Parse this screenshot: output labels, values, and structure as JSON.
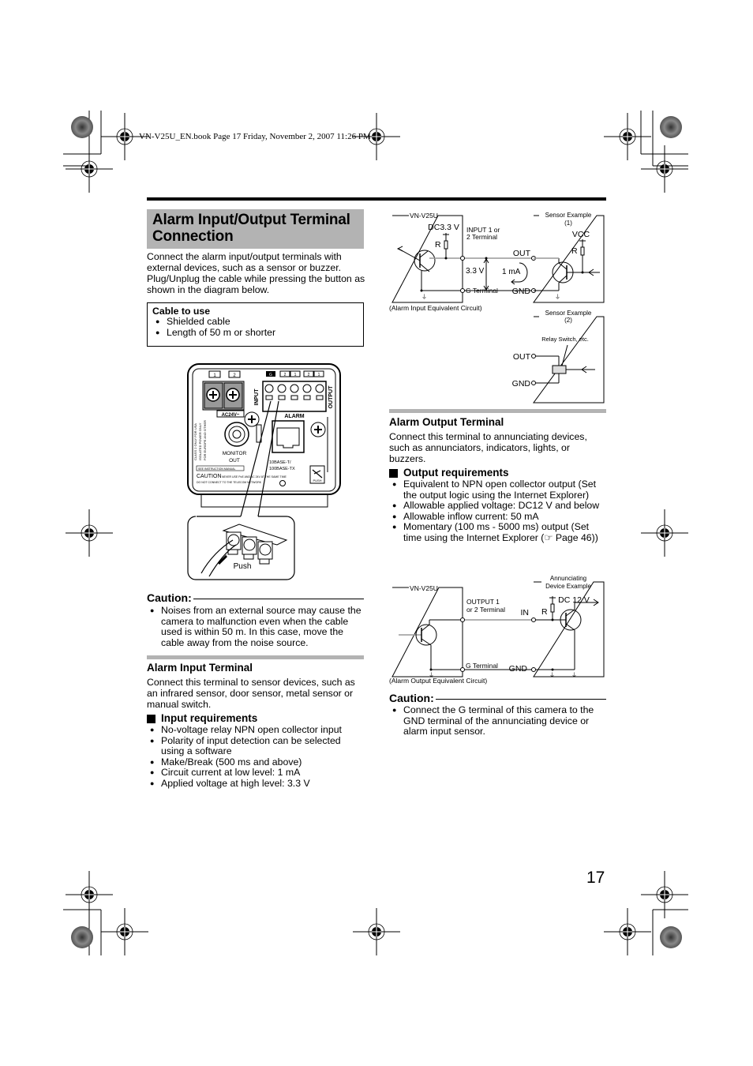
{
  "header": {
    "print_line": "VN-V25U_EN.book  Page 17  Friday, November 2, 2007  11:26 PM"
  },
  "page_title": "Alarm Input/Output Terminal Connection",
  "title_lines": [
    "Alarm Input/Output Terminal",
    "Connection"
  ],
  "intro": "Connect the alarm input/output terminals with external devices, such as a sensor or buzzer. Plug/Unplug the cable while pressing the button as shown in the diagram below.",
  "cable_box": {
    "heading": "Cable to use",
    "items": [
      "Shielded cable",
      "Length of 50 m or shorter"
    ]
  },
  "camera_diagram": {
    "power_terminals": [
      "1",
      "2"
    ],
    "power_label": "AC24V~",
    "alarm_terminals": [
      "G",
      "2",
      "1",
      "2",
      "1"
    ],
    "input_label": "INPUT",
    "output_label": "OUTPUT",
    "alarm_label": "ALARM",
    "monitor_label": [
      "MONITOR",
      "OUT"
    ],
    "network_label": [
      "10BASE-T/",
      "100BASE-TX"
    ],
    "poe_label": "PoE",
    "class2_label": [
      "CLASS 2 ONLY FOR USA",
      "ISOLATED POWER ONLY",
      "FOR EUROPE AND OTHER"
    ],
    "instruction_label": "SEE INSTRUCTION MANUAL",
    "caution_label": "CAUTION",
    "caution_small_1": "NEVER USE PoE AND AC 24V AT THE SAME TIME",
    "caution_small_2": "DO NOT CONNECT TO THE TELECOM NETWORK",
    "push_icon_label": "PUSH",
    "push_callout": "Push"
  },
  "caution_left": {
    "heading": "Caution:",
    "items": [
      "Noises from an external source may cause the camera to malfunction even when the cable used is within 50 m. In this case, move the cable away from the noise source."
    ]
  },
  "alarm_input": {
    "heading": "Alarm Input Terminal",
    "body": "Connect this terminal to sensor devices, such as an infrared sensor, door sensor, metal sensor or manual switch.",
    "req_heading": "Input requirements",
    "items": [
      "No-voltage relay NPN open collector input",
      "Polarity of input detection can be selected using a software",
      "Make/Break (500 ms and above)",
      "Circuit current at low level: 1 mA",
      "Applied voltage at high level: 3.3 V"
    ]
  },
  "input_circuit": {
    "device": "VN-V25U",
    "supply": "DC3.3 V",
    "resistor": "R",
    "terminal": [
      "INPUT 1 or",
      "2 Terminal"
    ],
    "voltage": "3.3 V",
    "current": "1 mA",
    "g_terminal": "G Terminal",
    "out": "OUT",
    "gnd": "GND",
    "sensor1": [
      "Sensor Example",
      "(1)"
    ],
    "vcc": "VCC",
    "caption": "(Alarm Input Equivalent Circuit)",
    "sensor2": [
      "Sensor Example",
      "(2)"
    ],
    "relay": "Relay Switch, etc."
  },
  "alarm_output": {
    "heading": "Alarm Output Terminal",
    "body": "Connect this terminal to annunciating devices, such as annunciators, indicators, lights, or buzzers.",
    "req_heading": "Output requirements",
    "items": [
      "Equivalent to NPN open collector output (Set the output logic using the Internet Explorer)",
      "Allowable applied voltage: DC12 V and below",
      "Allowable inflow current: 50 mA",
      "Momentary (100 ms - 5000 ms) output (Set time using the Internet Explorer (☞ Page 46))"
    ]
  },
  "output_circuit": {
    "device": "VN-V25U",
    "terminal": [
      "OUTPUT 1",
      "or 2 Terminal"
    ],
    "g_terminal": "G Terminal",
    "in": "IN",
    "gnd": "GND",
    "annunciator": [
      "Annunciating",
      "Device Example"
    ],
    "supply": "DC 12 V",
    "resistor": "R",
    "caption": "(Alarm Output Equivalent Circuit)"
  },
  "caution_right": {
    "heading": "Caution:",
    "items": [
      "Connect the G terminal of this camera to the GND terminal of the annunciating device or alarm input sensor."
    ]
  },
  "page_number": "17",
  "colors": {
    "section_gray": "#b3b3b3",
    "text": "#000000"
  }
}
